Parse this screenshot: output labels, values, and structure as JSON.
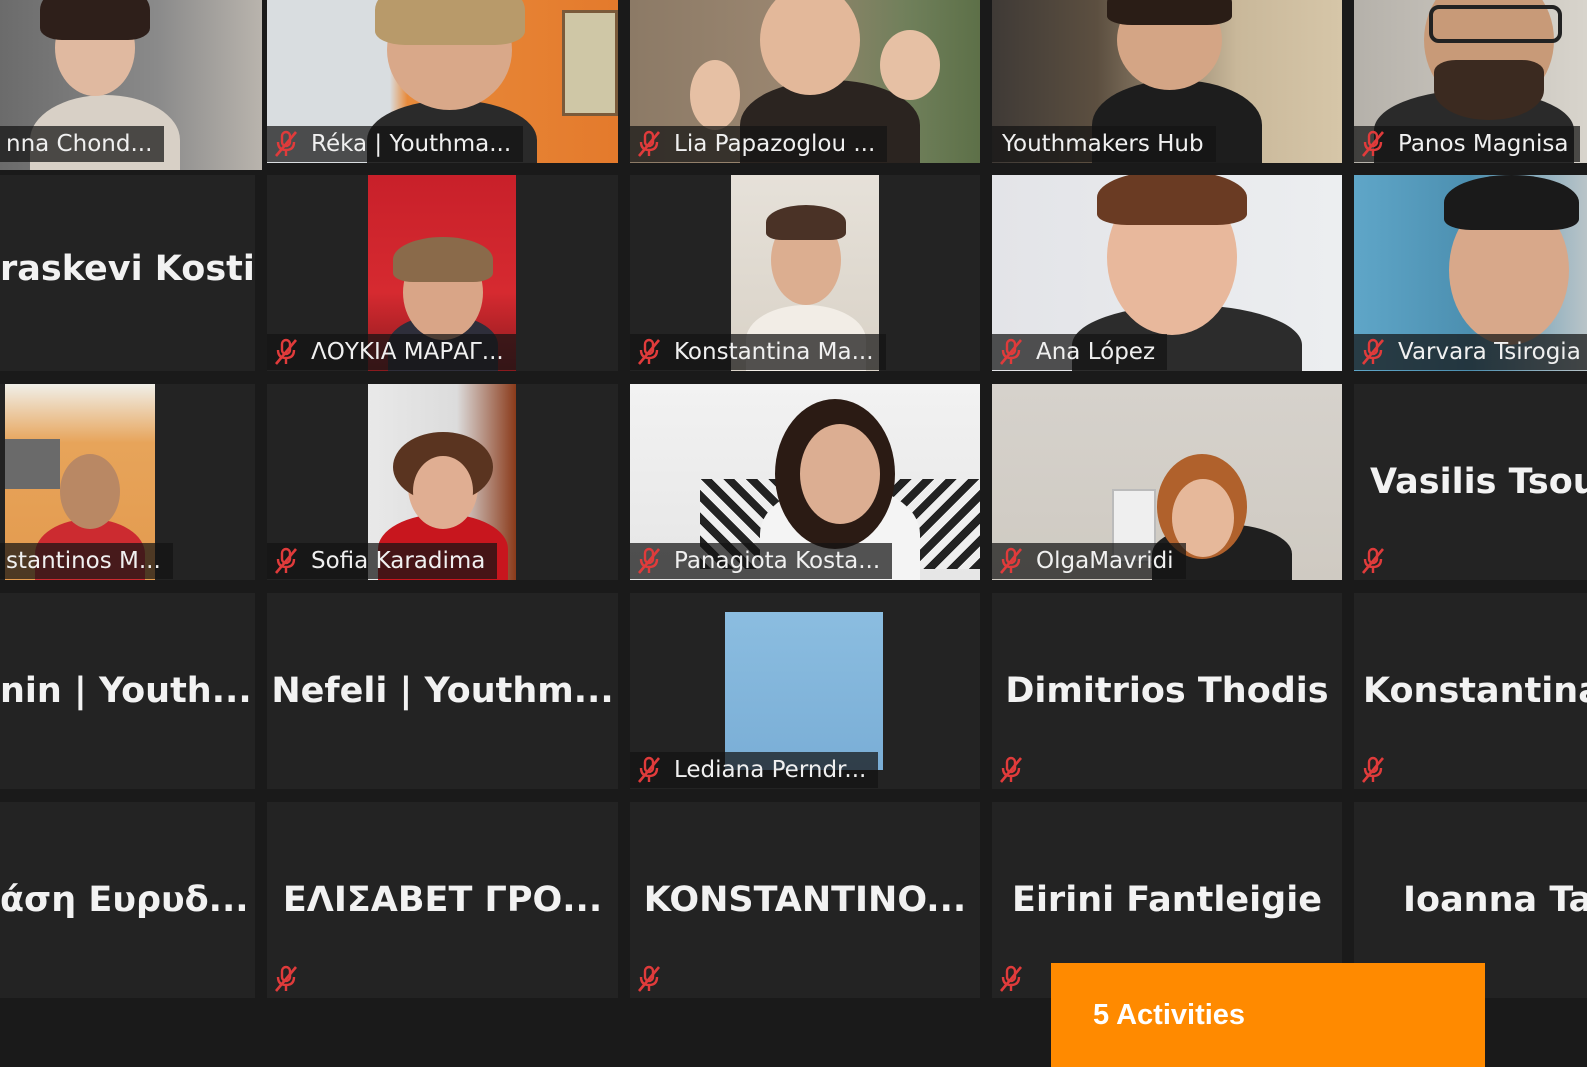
{
  "participants": {
    "p1": "nna Chond...",
    "p2": "Réka | Youthma...",
    "p3": "Lia Papazoglou ...",
    "p4": "Youthmakers Hub",
    "p5": "Panos Magnisa",
    "p6": "raskevi Kosti",
    "p7": "ΛΟΥΚΙΑ ΜΑΡΑΓ...",
    "p8": "Konstantina Ma...",
    "p9": "Ana López",
    "p10": "Varvara Tsirogia",
    "p11": "stantinos M...",
    "p12": "Sofia Karadima",
    "p13": "Panagiota Kosta...",
    "p14": "OlgaMavridi",
    "p15": "Vasilis  Tsou",
    "p16": "nin | Youth...",
    "p17": "Nefeli | Youthm...",
    "p18": "Lediana Perndr...",
    "p19": "Dimitrios Thodis",
    "p20": "Konstantina",
    "p21": "άση   Ευρυδ...",
    "p22": "ΕΛΙΣΑΒΕΤ  ΓΡΟ...",
    "p23": "KONSTANTINO...",
    "p24": "Eirini Fantleigie",
    "p25": "Ioanna Ta"
  },
  "icons": {
    "muted": "muted-mic-icon"
  },
  "colors": {
    "mute_red": "#e03b3b",
    "active_border": "#d7ee3e",
    "promo_bg": "#ff8a00"
  },
  "promo": {
    "label": "5 Activities"
  }
}
